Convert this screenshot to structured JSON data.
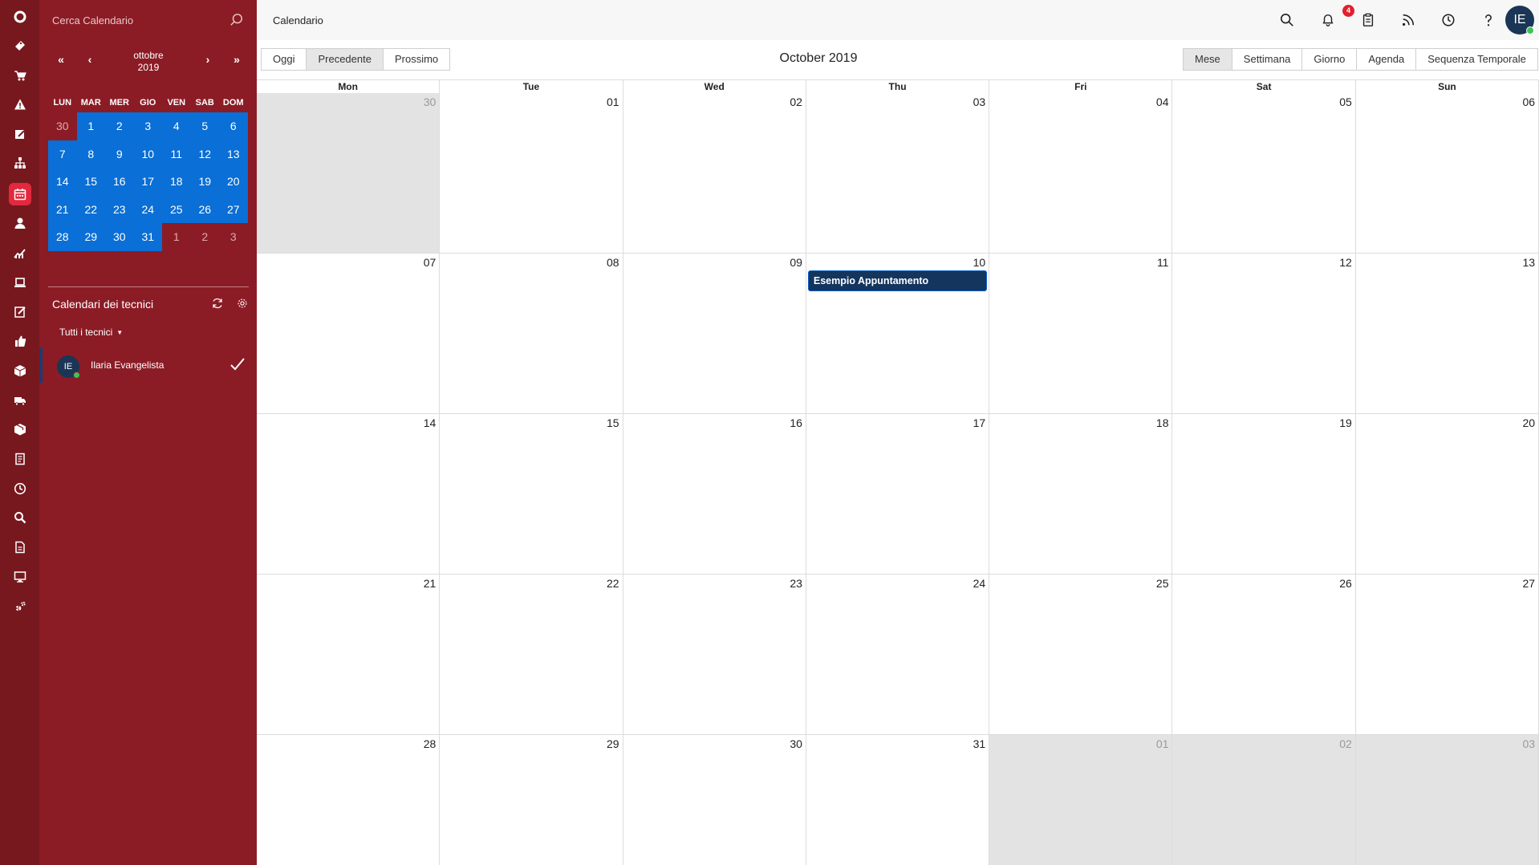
{
  "search": {
    "placeholder": "Cerca Calendario"
  },
  "rail": {
    "icons": [
      "logo-ring-icon",
      "ticket-icon",
      "cart-icon",
      "warning-icon",
      "edit-icon",
      "org-chart-icon",
      "calendar-icon",
      "user-icon",
      "chart-icon",
      "laptop-icon",
      "note-edit-icon",
      "thumbs-up-icon",
      "box-icon",
      "truck-icon",
      "package-icon",
      "document-icon",
      "clock-icon",
      "search-icon",
      "file-icon",
      "monitor-icon",
      "settings-icon"
    ],
    "active": "calendar-icon"
  },
  "minical": {
    "prev_year": "«",
    "prev_month": "‹",
    "next_month": "›",
    "next_year": "»",
    "month": "ottobre",
    "year": "2019",
    "weekdays": [
      "LUN",
      "MAR",
      "MER",
      "GIO",
      "VEN",
      "SAB",
      "DOM"
    ],
    "days": [
      {
        "d": "30",
        "in": false
      },
      {
        "d": "1",
        "in": true
      },
      {
        "d": "2",
        "in": true
      },
      {
        "d": "3",
        "in": true
      },
      {
        "d": "4",
        "in": true
      },
      {
        "d": "5",
        "in": true
      },
      {
        "d": "6",
        "in": true
      },
      {
        "d": "7",
        "in": true
      },
      {
        "d": "8",
        "in": true
      },
      {
        "d": "9",
        "in": true
      },
      {
        "d": "10",
        "in": true
      },
      {
        "d": "11",
        "in": true
      },
      {
        "d": "12",
        "in": true
      },
      {
        "d": "13",
        "in": true
      },
      {
        "d": "14",
        "in": true
      },
      {
        "d": "15",
        "in": true
      },
      {
        "d": "16",
        "in": true
      },
      {
        "d": "17",
        "in": true
      },
      {
        "d": "18",
        "in": true
      },
      {
        "d": "19",
        "in": true
      },
      {
        "d": "20",
        "in": true
      },
      {
        "d": "21",
        "in": true
      },
      {
        "d": "22",
        "in": true
      },
      {
        "d": "23",
        "in": true
      },
      {
        "d": "24",
        "in": true
      },
      {
        "d": "25",
        "in": true
      },
      {
        "d": "26",
        "in": true
      },
      {
        "d": "27",
        "in": true
      },
      {
        "d": "28",
        "in": true
      },
      {
        "d": "29",
        "in": true
      },
      {
        "d": "30",
        "in": true
      },
      {
        "d": "31",
        "in": true
      },
      {
        "d": "1",
        "in": false
      },
      {
        "d": "2",
        "in": false
      },
      {
        "d": "3",
        "in": false
      }
    ]
  },
  "technicians": {
    "title": "Calendari dei tecnici",
    "filter": "Tutti i tecnici",
    "items": [
      {
        "initials": "IE",
        "name": "Ilaria Evangelista",
        "checked": true
      }
    ]
  },
  "topbar": {
    "title": "Calendario",
    "notification_count": "4",
    "user_initials": "IE"
  },
  "toolbar": {
    "today": "Oggi",
    "previous": "Precedente",
    "next": "Prossimo",
    "month_title": "October 2019",
    "views": [
      "Mese",
      "Settimana",
      "Giorno",
      "Agenda",
      "Sequenza Temporale"
    ],
    "active_view": "Mese"
  },
  "calendar": {
    "weekdays": [
      "Mon",
      "Tue",
      "Wed",
      "Thu",
      "Fri",
      "Sat",
      "Sun"
    ],
    "days": [
      {
        "d": "30",
        "in": false
      },
      {
        "d": "01",
        "in": true
      },
      {
        "d": "02",
        "in": true
      },
      {
        "d": "03",
        "in": true
      },
      {
        "d": "04",
        "in": true
      },
      {
        "d": "05",
        "in": true
      },
      {
        "d": "06",
        "in": true
      },
      {
        "d": "07",
        "in": true
      },
      {
        "d": "08",
        "in": true
      },
      {
        "d": "09",
        "in": true
      },
      {
        "d": "10",
        "in": true,
        "event": "Esempio Appuntamento"
      },
      {
        "d": "11",
        "in": true
      },
      {
        "d": "12",
        "in": true
      },
      {
        "d": "13",
        "in": true
      },
      {
        "d": "14",
        "in": true
      },
      {
        "d": "15",
        "in": true
      },
      {
        "d": "16",
        "in": true
      },
      {
        "d": "17",
        "in": true
      },
      {
        "d": "18",
        "in": true
      },
      {
        "d": "19",
        "in": true
      },
      {
        "d": "20",
        "in": true
      },
      {
        "d": "21",
        "in": true
      },
      {
        "d": "22",
        "in": true
      },
      {
        "d": "23",
        "in": true
      },
      {
        "d": "24",
        "in": true
      },
      {
        "d": "25",
        "in": true
      },
      {
        "d": "26",
        "in": true
      },
      {
        "d": "27",
        "in": true
      },
      {
        "d": "28",
        "in": true
      },
      {
        "d": "29",
        "in": true
      },
      {
        "d": "30",
        "in": true
      },
      {
        "d": "31",
        "in": true
      },
      {
        "d": "01",
        "in": false
      },
      {
        "d": "02",
        "in": false
      },
      {
        "d": "03",
        "in": false
      }
    ]
  },
  "colors": {
    "rail": "#77181f",
    "panel": "#8b1c25",
    "minical_highlight": "#0a6fd6",
    "event": "#13355e",
    "active_rail_icon": "#e2293d"
  }
}
